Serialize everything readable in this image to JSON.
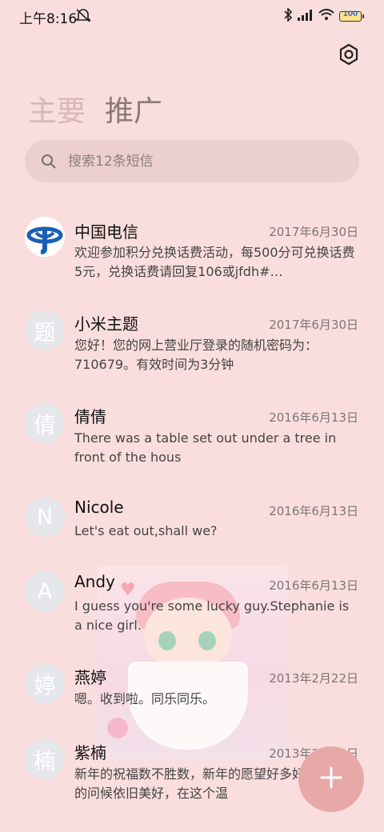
{
  "status_bar": {
    "time": "上午8:16",
    "battery": "100"
  },
  "tabs": {
    "main": "主要",
    "promo": "推广"
  },
  "search": {
    "placeholder": "搜索12条短信"
  },
  "conversations": [
    {
      "name": "中国电信",
      "date": "2017年6月30日",
      "preview": "欢迎参加积分兑换话费活动，每500分可兑换话费5元，兑换话费请回复106或jfdh#…",
      "avatar": ""
    },
    {
      "name": "小米主题",
      "date": "2017年6月30日",
      "preview": "您好！您的网上营业厅登录的随机密码为：710679。有效时间为3分钟",
      "avatar": "题"
    },
    {
      "name": "倩倩",
      "date": "2016年6月13日",
      "preview": "There was a table set out under a tree in front of the hous",
      "avatar": "倩"
    },
    {
      "name": "Nicole",
      "date": "2016年6月13日",
      "preview": "Let's eat out,shall we?",
      "avatar": "N"
    },
    {
      "name": "Andy",
      "date": "2016年6月13日",
      "preview": "I guess you're some lucky guy.Stephanie is a nice girl.",
      "avatar": "A"
    },
    {
      "name": "燕婷",
      "date": "2013年2月22日",
      "preview": "嗯。收到啦。同乐同乐。",
      "avatar": "婷"
    },
    {
      "name": "紫楠",
      "date": "2013年2月22日",
      "preview": "新年的祝福数不胜数，新年的愿望好多好多，新年的问候依旧美好，在这个温",
      "avatar": "楠"
    }
  ],
  "icons": {
    "settings": "gear-icon",
    "search": "search-icon",
    "fab": "plus-icon",
    "telecom": "china-telecom-logo"
  },
  "colors": {
    "background": "#f9dedd",
    "accent": "#e6a9a8"
  }
}
